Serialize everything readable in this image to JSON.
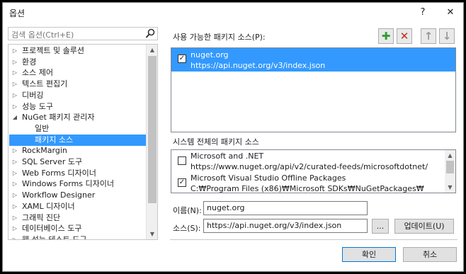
{
  "window": {
    "title": "옵션",
    "help_glyph": "?",
    "close_glyph": "✕"
  },
  "search": {
    "placeholder": "검색 옵션(Ctrl+E)"
  },
  "tree": {
    "items": [
      {
        "label": "프로젝트 및 솔루션",
        "level": 0,
        "expandable": true,
        "expanded": false,
        "selected": false
      },
      {
        "label": "환경",
        "level": 0,
        "expandable": true,
        "expanded": false,
        "selected": false
      },
      {
        "label": "소스 제어",
        "level": 0,
        "expandable": true,
        "expanded": false,
        "selected": false
      },
      {
        "label": "텍스트 편집기",
        "level": 0,
        "expandable": true,
        "expanded": false,
        "selected": false
      },
      {
        "label": "디버깅",
        "level": 0,
        "expandable": true,
        "expanded": false,
        "selected": false
      },
      {
        "label": "성능 도구",
        "level": 0,
        "expandable": true,
        "expanded": false,
        "selected": false
      },
      {
        "label": "NuGet 패키지 관리자",
        "level": 0,
        "expandable": true,
        "expanded": true,
        "selected": false
      },
      {
        "label": "일반",
        "level": 1,
        "expandable": false,
        "expanded": false,
        "selected": false
      },
      {
        "label": "패키지 소스",
        "level": 1,
        "expandable": false,
        "expanded": false,
        "selected": true
      },
      {
        "label": "RockMargin",
        "level": 0,
        "expandable": true,
        "expanded": false,
        "selected": false
      },
      {
        "label": "SQL Server 도구",
        "level": 0,
        "expandable": true,
        "expanded": false,
        "selected": false
      },
      {
        "label": "Web Forms 디자이너",
        "level": 0,
        "expandable": true,
        "expanded": false,
        "selected": false
      },
      {
        "label": "Windows Forms 디자이너",
        "level": 0,
        "expandable": true,
        "expanded": false,
        "selected": false
      },
      {
        "label": "Workflow Designer",
        "level": 0,
        "expandable": true,
        "expanded": false,
        "selected": false
      },
      {
        "label": "XAML 디자이너",
        "level": 0,
        "expandable": true,
        "expanded": false,
        "selected": false
      },
      {
        "label": "그래픽 진단",
        "level": 0,
        "expandable": true,
        "expanded": false,
        "selected": false
      },
      {
        "label": "데이터베이스 도구",
        "level": 0,
        "expandable": true,
        "expanded": false,
        "selected": false
      },
      {
        "label": "웹 성능 테스트 도구",
        "level": 0,
        "expandable": true,
        "expanded": false,
        "selected": false
      }
    ]
  },
  "available": {
    "label": "사용 가능한 패키지 소스(P):",
    "toolbar": [
      {
        "name": "add",
        "glyph": "✚",
        "color": "#2e9e2e"
      },
      {
        "name": "remove",
        "glyph": "✕",
        "color": "#c42b1c"
      },
      {
        "name": "move-up",
        "glyph": "↑",
        "color": "#9a9a9a"
      },
      {
        "name": "move-down",
        "glyph": "↓",
        "color": "#9a9a9a"
      }
    ],
    "items": [
      {
        "name": "nuget.org",
        "source": "https://api.nuget.org/v3/index.json",
        "checked": true,
        "selected": true
      }
    ]
  },
  "system": {
    "label": "시스템 전체의 패키지 소스",
    "items": [
      {
        "name": "Microsoft and .NET",
        "source": "https://www.nuget.org/api/v2/curated-feeds/microsoftdotnet/",
        "checked": false
      },
      {
        "name": "Microsoft Visual Studio Offline Packages",
        "source": "C:₩Program Files (x86)₩Microsoft SDKs₩NuGetPackages₩",
        "checked": true
      }
    ]
  },
  "form": {
    "name_label": "이름(N):",
    "name_value": "nuget.org",
    "source_label": "소스(S):",
    "source_value": "https://api.nuget.org/v3/index.json",
    "browse_label": "...",
    "update_label": "업데이트(U)"
  },
  "buttons": {
    "ok": "확인",
    "cancel": "취소"
  },
  "colors": {
    "selection": "#3399ff",
    "add": "#2e9e2e",
    "remove": "#c42b1c"
  }
}
